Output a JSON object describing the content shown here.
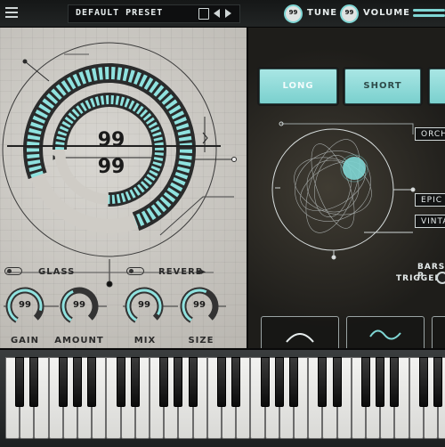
{
  "header": {
    "preset_name": "DEFAULT PRESET",
    "tune": {
      "label": "TUNE",
      "value": "99"
    },
    "volume": {
      "label": "VOLUME",
      "value": "99"
    }
  },
  "main_dial": {
    "value_top": "99",
    "value_bottom": "99"
  },
  "effects": {
    "glass": {
      "label": "GLASS"
    },
    "reverb": {
      "label": "REVERB",
      "extra": "◂▸"
    }
  },
  "knobs": [
    {
      "label": "GAIN",
      "value": "99"
    },
    {
      "label": "AMOUNT",
      "value": "99"
    },
    {
      "label": "MIX",
      "value": "99"
    },
    {
      "label": "SIZE",
      "value": "99"
    }
  ],
  "modes": [
    "LONG",
    "SHORT"
  ],
  "tags": [
    "ORCH",
    "EPIC A",
    "VINTA"
  ],
  "bars": {
    "label": "BARS P",
    "trigger": "TRIGGER"
  },
  "colors": {
    "accent": "#7fd6d4",
    "panel_light": "#cfccc6",
    "panel_dark": "#2b2924"
  }
}
